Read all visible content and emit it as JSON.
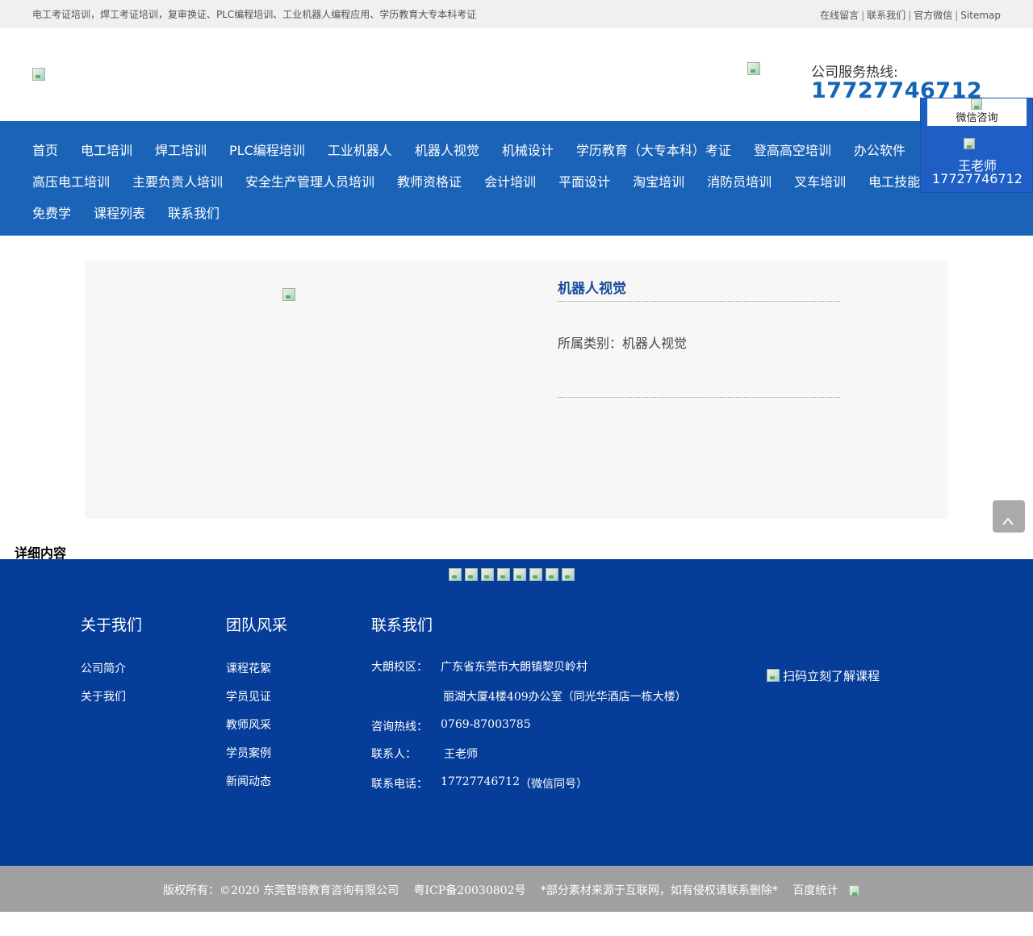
{
  "topbar": {
    "tagline": "电工考证培训，焊工考证培训，复审换证、PLC编程培训、工业机器人编程应用、学历教育大专本科考证",
    "links": [
      "在线留言",
      "联系我们",
      "官方微信",
      "Sitemap"
    ]
  },
  "header": {
    "hotline_label": "公司服务热线:",
    "hotline_number": "17727746712"
  },
  "nav": {
    "row1": [
      "首页",
      "电工培训",
      "焊工培训",
      "PLC编程培训",
      "工业机器人",
      "机器人视觉",
      "机械设计",
      "学历教育（大专本科）考证",
      "登高高空培训",
      "办公软件"
    ],
    "row2": [
      "高压电工培训",
      "主要负责人培训",
      "安全生产管理人员培训",
      "教师资格证",
      "会计培训",
      "平面设计",
      "淘宝培训",
      "消防员培训",
      "叉车培训",
      "电工技能"
    ],
    "row3": [
      "免费学",
      "课程列表",
      "联系我们"
    ]
  },
  "float_widget": {
    "wechat_label": "微信咨询",
    "teacher_name": "王老师",
    "teacher_phone": "17727746712"
  },
  "product": {
    "title": "机器人视觉",
    "category": "所属类别：机器人视觉"
  },
  "detail": {
    "heading": "详细内容"
  },
  "footer": {
    "about": {
      "title": "关于我们",
      "links": [
        "公司简介",
        "关于我们"
      ]
    },
    "team": {
      "title": "团队风采",
      "links": [
        "课程花絮",
        "学员见证",
        "教师风采",
        "学员案例",
        "新闻动态"
      ]
    },
    "contact": {
      "title": "联系我们",
      "campus_label": "大朗校区：",
      "campus_address_1": "广东省东莞市大朗镇黎贝岭村",
      "campus_address_2": "丽湖大厦4楼409办公室（同光华酒店一栋大楼）",
      "hotline_label": "咨询热线：",
      "hotline_value": "0769-87003785",
      "person_label": "联系人：",
      "person_value": "王老师",
      "phone_label": "联系电话：",
      "phone_value": "17727746712",
      "phone_note": "（微信同号）"
    },
    "qr_text": "扫码立刻了解课程"
  },
  "copyright": {
    "rights": "版权所有：©2020  东莞智培教育咨询有限公司",
    "icp": "粤ICP备20030802号",
    "notice": "*部分素材来源于互联网，如有侵权请联系删除*",
    "stats": "百度统计"
  }
}
